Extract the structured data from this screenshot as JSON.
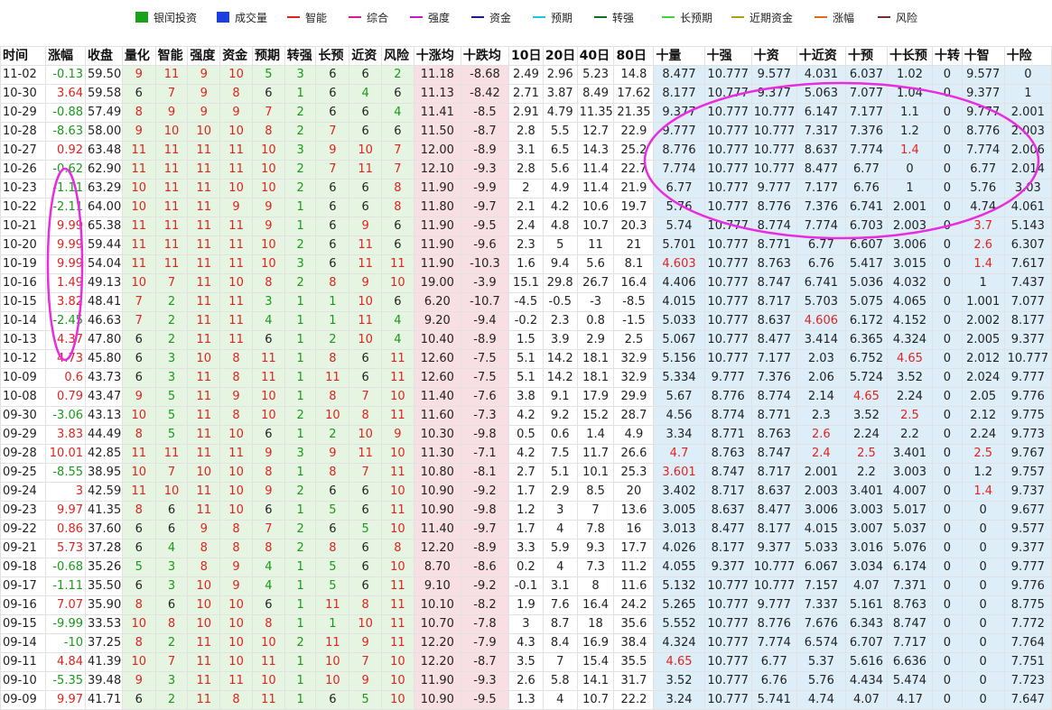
{
  "legend": [
    {
      "label": "银闰投资",
      "color": "#1aa11a",
      "kind": "box"
    },
    {
      "label": "成交量",
      "color": "#1a3ee0",
      "kind": "box"
    },
    {
      "label": "智能",
      "color": "#e0231f",
      "kind": "line"
    },
    {
      "label": "综合",
      "color": "#e01a8a",
      "kind": "line"
    },
    {
      "label": "强度",
      "color": "#c11ac6",
      "kind": "line"
    },
    {
      "label": "资金",
      "color": "#1a1a8a",
      "kind": "line"
    },
    {
      "label": "预期",
      "color": "#1ac6e0",
      "kind": "line"
    },
    {
      "label": "转强",
      "color": "#0e6e1a",
      "kind": "line"
    },
    {
      "label": "长预期",
      "color": "#3ad63a",
      "kind": "line"
    },
    {
      "label": "近期资金",
      "color": "#b89a1a",
      "kind": "line"
    },
    {
      "label": "涨幅",
      "color": "#e0681a",
      "kind": "line"
    },
    {
      "label": "风险",
      "color": "#7a2a2a",
      "kind": "line"
    }
  ],
  "headers": [
    "时间",
    "涨幅",
    "收盘",
    "量化",
    "智能",
    "强度",
    "资金",
    "预期",
    "转强",
    "长预",
    "近资",
    "风险",
    "十涨均",
    "十跌均",
    "10日",
    "20日",
    "40日",
    "80日",
    "十量",
    "十强",
    "十资",
    "十近资",
    "十预",
    "十长预",
    "十转",
    "十智",
    "十险"
  ],
  "rows": [
    [
      "11-02",
      "-0.13",
      "59.50",
      "9",
      "11",
      "9",
      "10",
      "5",
      "3",
      "6",
      "6",
      "2",
      "11.18",
      "-8.68",
      "2.49",
      "2.96",
      "5.23",
      "14.8",
      "8.477",
      "10.777",
      "9.577",
      "4.031",
      "6.037",
      "1.02",
      "0",
      "9.577",
      "0"
    ],
    [
      "10-30",
      "3.64",
      "59.58",
      "6",
      "7",
      "9",
      "8",
      "6",
      "1",
      "6",
      "4",
      "6",
      "11.13",
      "-8.42",
      "2.71",
      "3.87",
      "8.49",
      "17.62",
      "8.177",
      "10.777",
      "9.377",
      "5.063",
      "7.077",
      "1.04",
      "0",
      "9.377",
      "1"
    ],
    [
      "10-29",
      "-0.88",
      "57.49",
      "8",
      "9",
      "9",
      "9",
      "7",
      "2",
      "6",
      "6",
      "4",
      "11.41",
      "-8.5",
      "2.91",
      "4.79",
      "11.35",
      "21.35",
      "9.377",
      "10.777",
      "10.777",
      "6.147",
      "7.177",
      "1.1",
      "0",
      "9.777",
      "2.001"
    ],
    [
      "10-28",
      "-8.63",
      "58.00",
      "9",
      "10",
      "10",
      "10",
      "8",
      "2",
      "7",
      "6",
      "6",
      "11.50",
      "-8.7",
      "2.8",
      "5.5",
      "12.7",
      "22.9",
      "9.777",
      "10.777",
      "10.777",
      "7.317",
      "7.376",
      "1.2",
      "0",
      "8.776",
      "2.003"
    ],
    [
      "10-27",
      "0.92",
      "63.48",
      "11",
      "11",
      "11",
      "11",
      "10",
      "3",
      "9",
      "10",
      "7",
      "12.00",
      "-8.9",
      "3.1",
      "6.5",
      "14.3",
      "25.2",
      "8.776",
      "10.777",
      "10.777",
      "8.637",
      "7.774",
      "1.4",
      "0",
      "7.774",
      "2.006"
    ],
    [
      "10-26",
      "-0.62",
      "62.90",
      "11",
      "11",
      "11",
      "11",
      "10",
      "2",
      "7",
      "11",
      "7",
      "12.10",
      "-9.3",
      "2.8",
      "5.6",
      "11.4",
      "22.7",
      "7.774",
      "10.777",
      "10.777",
      "8.477",
      "6.77",
      "0",
      "0",
      "6.77",
      "2.014"
    ],
    [
      "10-23",
      "-1.11",
      "63.29",
      "10",
      "11",
      "11",
      "10",
      "10",
      "2",
      "6",
      "6",
      "8",
      "11.90",
      "-9.9",
      "2",
      "4.9",
      "11.4",
      "21.9",
      "6.77",
      "10.777",
      "9.777",
      "7.177",
      "6.76",
      "1",
      "0",
      "5.76",
      "3.03"
    ],
    [
      "10-22",
      "-2.11",
      "64.00",
      "10",
      "11",
      "11",
      "9",
      "9",
      "1",
      "6",
      "6",
      "8",
      "11.80",
      "-9.7",
      "2.1",
      "4.2",
      "10.6",
      "19.7",
      "5.76",
      "10.777",
      "8.776",
      "7.376",
      "6.741",
      "2.001",
      "0",
      "4.74",
      "4.061"
    ],
    [
      "10-21",
      "9.99",
      "65.38",
      "11",
      "11",
      "11",
      "11",
      "9",
      "1",
      "6",
      "9",
      "6",
      "11.90",
      "-9.5",
      "2.4",
      "4.8",
      "10.7",
      "20.3",
      "5.74",
      "10.777",
      "8.774",
      "7.774",
      "6.703",
      "2.003",
      "0",
      "3.7",
      "5.143"
    ],
    [
      "10-20",
      "9.99",
      "59.44",
      "11",
      "11",
      "11",
      "11",
      "10",
      "2",
      "6",
      "11",
      "6",
      "11.90",
      "-9.6",
      "2.3",
      "5",
      "11",
      "21",
      "5.701",
      "10.777",
      "8.771",
      "6.77",
      "6.607",
      "3.006",
      "0",
      "2.6",
      "6.307"
    ],
    [
      "10-19",
      "9.99",
      "54.04",
      "11",
      "11",
      "11",
      "11",
      "10",
      "3",
      "6",
      "11",
      "11",
      "11.90",
      "-10.3",
      "1.6",
      "9.4",
      "5.6",
      "8.1",
      "4.603",
      "10.777",
      "8.763",
      "6.76",
      "5.417",
      "3.015",
      "0",
      "1.4",
      "7.617"
    ],
    [
      "10-16",
      "1.49",
      "49.13",
      "10",
      "7",
      "11",
      "10",
      "8",
      "2",
      "8",
      "9",
      "10",
      "19.00",
      "-3.9",
      "15.1",
      "29.8",
      "26.7",
      "16.4",
      "4.406",
      "10.777",
      "8.747",
      "6.741",
      "5.036",
      "4.032",
      "0",
      "1",
      "7.437"
    ],
    [
      "10-15",
      "3.82",
      "48.41",
      "7",
      "2",
      "11",
      "11",
      "3",
      "1",
      "1",
      "10",
      "6",
      "6.20",
      "-10.7",
      "-4.5",
      "-0.5",
      "-3",
      "-8.5",
      "4.015",
      "10.777",
      "8.717",
      "5.703",
      "5.075",
      "4.065",
      "0",
      "1.001",
      "7.077"
    ],
    [
      "10-14",
      "-2.45",
      "46.63",
      "7",
      "2",
      "11",
      "11",
      "4",
      "1",
      "1",
      "11",
      "4",
      "9.20",
      "-9.4",
      "-0.2",
      "2.3",
      "0.8",
      "-1.5",
      "5.033",
      "10.777",
      "8.637",
      "4.606",
      "6.172",
      "4.152",
      "0",
      "2.002",
      "8.177"
    ],
    [
      "10-13",
      "4.37",
      "47.80",
      "6",
      "2",
      "11",
      "11",
      "6",
      "1",
      "2",
      "10",
      "4",
      "10.40",
      "-8.9",
      "1.5",
      "3.9",
      "2.9",
      "2.5",
      "5.067",
      "10.777",
      "8.477",
      "3.414",
      "6.365",
      "4.324",
      "0",
      "2.005",
      "9.377"
    ],
    [
      "10-12",
      "4.73",
      "45.80",
      "6",
      "3",
      "10",
      "8",
      "11",
      "1",
      "8",
      "6",
      "11",
      "12.60",
      "-7.5",
      "5.1",
      "14.2",
      "18.1",
      "32.9",
      "5.156",
      "10.777",
      "7.177",
      "2.03",
      "6.752",
      "4.65",
      "0",
      "2.012",
      "10.777"
    ],
    [
      "10-09",
      "0.6",
      "43.73",
      "6",
      "3",
      "11",
      "8",
      "11",
      "1",
      "11",
      "6",
      "11",
      "12.60",
      "-7.5",
      "5.1",
      "14.2",
      "18.1",
      "32.9",
      "5.334",
      "9.777",
      "7.376",
      "2.06",
      "5.724",
      "3.52",
      "0",
      "2.024",
      "9.777"
    ],
    [
      "10-08",
      "0.79",
      "43.47",
      "9",
      "5",
      "11",
      "9",
      "10",
      "1",
      "8",
      "7",
      "10",
      "11.40",
      "-7.6",
      "3.8",
      "9.1",
      "17.9",
      "29.9",
      "5.67",
      "8.776",
      "8.774",
      "2.14",
      "4.65",
      "2.24",
      "0",
      "2.05",
      "9.776"
    ],
    [
      "09-30",
      "-3.06",
      "43.13",
      "10",
      "5",
      "11",
      "8",
      "10",
      "2",
      "10",
      "8",
      "11",
      "11.60",
      "-7.3",
      "4.2",
      "9.2",
      "15.2",
      "28.7",
      "4.56",
      "8.774",
      "8.771",
      "2.3",
      "3.52",
      "2.5",
      "0",
      "2.12",
      "9.775"
    ],
    [
      "09-29",
      "3.83",
      "44.49",
      "8",
      "5",
      "11",
      "10",
      "6",
      "1",
      "2",
      "10",
      "9",
      "10.30",
      "-9.8",
      "0.5",
      "0.6",
      "1.4",
      "4.9",
      "3.34",
      "8.771",
      "8.763",
      "2.6",
      "2.24",
      "2.2",
      "0",
      "2.24",
      "9.773"
    ],
    [
      "09-28",
      "10.01",
      "42.85",
      "11",
      "11",
      "11",
      "11",
      "9",
      "3",
      "9",
      "11",
      "10",
      "11.30",
      "-7.1",
      "4.2",
      "7.5",
      "11.7",
      "26.6",
      "4.7",
      "8.763",
      "8.747",
      "2.4",
      "2.5",
      "3.401",
      "0",
      "2.5",
      "9.767"
    ],
    [
      "09-25",
      "-8.55",
      "38.95",
      "10",
      "7",
      "10",
      "10",
      "8",
      "1",
      "8",
      "7",
      "11",
      "10.80",
      "-8.1",
      "2.7",
      "5.1",
      "10.1",
      "25.3",
      "3.601",
      "8.747",
      "8.717",
      "2.001",
      "2.2",
      "3.003",
      "0",
      "1.2",
      "9.757"
    ],
    [
      "09-24",
      "3",
      "42.59",
      "11",
      "10",
      "11",
      "10",
      "9",
      "2",
      "6",
      "6",
      "10",
      "10.90",
      "-9.2",
      "1.7",
      "2.9",
      "8.5",
      "20",
      "3.402",
      "8.717",
      "8.637",
      "2.003",
      "3.401",
      "4.007",
      "0",
      "1.4",
      "9.737"
    ],
    [
      "09-23",
      "9.97",
      "41.35",
      "8",
      "6",
      "11",
      "10",
      "6",
      "1",
      "5",
      "6",
      "11",
      "10.90",
      "-9.8",
      "1.2",
      "3",
      "7",
      "13.6",
      "3.005",
      "8.637",
      "8.477",
      "3.006",
      "3.003",
      "5.017",
      "0",
      "0",
      "9.677"
    ],
    [
      "09-22",
      "0.86",
      "37.60",
      "6",
      "6",
      "9",
      "8",
      "7",
      "2",
      "6",
      "5",
      "10",
      "11.40",
      "-9.7",
      "1.7",
      "4",
      "7.8",
      "16",
      "3.013",
      "8.477",
      "8.177",
      "4.015",
      "3.007",
      "5.037",
      "0",
      "0",
      "9.577"
    ],
    [
      "09-21",
      "5.73",
      "37.28",
      "6",
      "4",
      "8",
      "8",
      "8",
      "2",
      "8",
      "6",
      "8",
      "12.20",
      "-8.9",
      "3.3",
      "5.9",
      "9.3",
      "17.7",
      "4.026",
      "8.177",
      "9.377",
      "5.033",
      "3.016",
      "5.076",
      "0",
      "0",
      "9.377"
    ],
    [
      "09-18",
      "-0.68",
      "35.26",
      "5",
      "3",
      "8",
      "9",
      "4",
      "1",
      "5",
      "6",
      "10",
      "8.70",
      "-8.6",
      "0.2",
      "4",
      "7.3",
      "11.2",
      "4.055",
      "9.377",
      "10.777",
      "6.067",
      "3.034",
      "6.174",
      "0",
      "0",
      "9.777"
    ],
    [
      "09-17",
      "-1.11",
      "35.50",
      "6",
      "3",
      "10",
      "9",
      "4",
      "1",
      "5",
      "6",
      "11",
      "9.10",
      "-9.2",
      "-0.1",
      "3.1",
      "8",
      "11.6",
      "5.132",
      "10.777",
      "10.777",
      "7.157",
      "4.07",
      "7.371",
      "0",
      "0",
      "9.776"
    ],
    [
      "09-16",
      "7.07",
      "35.90",
      "8",
      "6",
      "10",
      "10",
      "6",
      "1",
      "11",
      "8",
      "11",
      "10.10",
      "-8.2",
      "1.9",
      "7.6",
      "16.4",
      "24.2",
      "5.265",
      "10.777",
      "9.777",
      "7.337",
      "5.161",
      "8.763",
      "0",
      "0",
      "8.775"
    ],
    [
      "09-15",
      "-9.99",
      "33.53",
      "10",
      "8",
      "10",
      "10",
      "8",
      "1",
      "1",
      "10",
      "11",
      "10.70",
      "-7.8",
      "3",
      "8.7",
      "18",
      "35.6",
      "5.552",
      "10.777",
      "8.776",
      "7.676",
      "6.343",
      "8.747",
      "0",
      "0",
      "7.772"
    ],
    [
      "09-14",
      "-10",
      "37.25",
      "8",
      "2",
      "11",
      "10",
      "10",
      "2",
      "11",
      "9",
      "11",
      "12.20",
      "-7.9",
      "4.3",
      "8.4",
      "16.9",
      "38.4",
      "4.324",
      "10.777",
      "7.774",
      "6.574",
      "6.707",
      "7.717",
      "0",
      "0",
      "7.764"
    ],
    [
      "09-11",
      "4.84",
      "41.39",
      "10",
      "7",
      "11",
      "10",
      "11",
      "1",
      "10",
      "7",
      "10",
      "12.20",
      "-8.7",
      "3.5",
      "7",
      "15.4",
      "35.5",
      "4.65",
      "10.777",
      "6.77",
      "5.37",
      "5.616",
      "6.636",
      "0",
      "0",
      "7.751"
    ],
    [
      "09-10",
      "-5.35",
      "39.48",
      "9",
      "3",
      "11",
      "11",
      "10",
      "1",
      "10",
      "9",
      "10",
      "11.90",
      "-9.3",
      "2.6",
      "5.8",
      "14.1",
      "31.7",
      "3.52",
      "10.777",
      "6.76",
      "5.76",
      "4.434",
      "5.474",
      "0",
      "0",
      "7.723"
    ],
    [
      "09-09",
      "9.97",
      "41.71",
      "6",
      "2",
      "11",
      "8",
      "11",
      "1",
      "6",
      "5",
      "10",
      "10.90",
      "-9.5",
      "1.3",
      "4",
      "10.7",
      "22.2",
      "3.24",
      "10.777",
      "5.741",
      "4.74",
      "4.07",
      "4.17",
      "0",
      "0",
      "7.647"
    ]
  ],
  "highlight_red": [
    [
      4,
      23
    ],
    [
      8,
      25
    ],
    [
      9,
      25
    ],
    [
      10,
      18
    ],
    [
      10,
      25
    ],
    [
      13,
      21
    ],
    [
      15,
      23
    ],
    [
      17,
      22
    ],
    [
      18,
      23
    ],
    [
      19,
      21
    ],
    [
      20,
      18
    ],
    [
      20,
      21
    ],
    [
      20,
      22
    ],
    [
      20,
      25
    ],
    [
      21,
      18
    ],
    [
      22,
      25
    ],
    [
      31,
      18
    ]
  ]
}
